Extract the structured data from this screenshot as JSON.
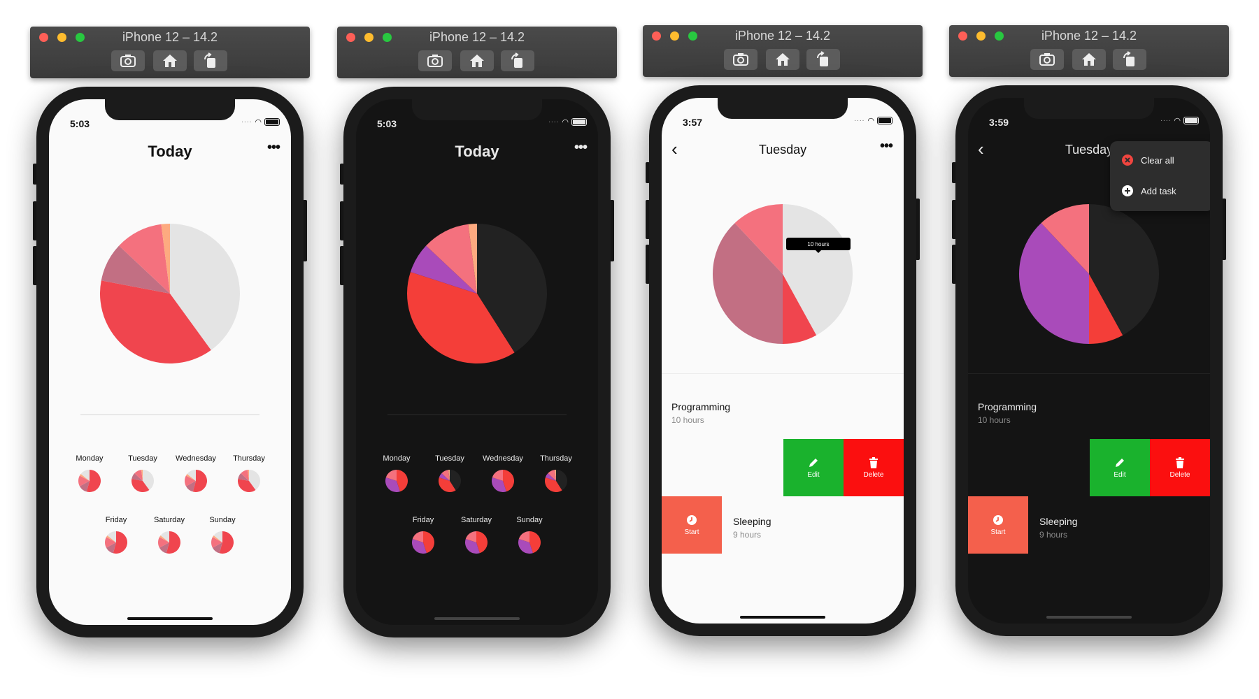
{
  "simulators": [
    {
      "theme": "light",
      "window_title": "iPhone 12 – 14.2",
      "time": "5:03",
      "title": "Today"
    },
    {
      "theme": "dark",
      "window_title": "iPhone 12 – 14.2",
      "time": "5:03",
      "title": "Today"
    },
    {
      "theme": "light",
      "window_title": "iPhone 12 – 14.2",
      "time": "3:57",
      "title": "Tuesday"
    },
    {
      "theme": "dark",
      "window_title": "iPhone 12 – 14.2",
      "time": "3:59",
      "title": "Tuesday"
    }
  ],
  "toolbar_icons": [
    "screenshot-icon",
    "home-icon",
    "rotate-icon"
  ],
  "days": [
    "Monday",
    "Tuesday",
    "Wednesday",
    "Thursday",
    "Friday",
    "Saturday",
    "Sunday"
  ],
  "tasks": [
    {
      "name": "Programming",
      "duration": "10 hours"
    },
    {
      "name": "Sleeping",
      "duration": "9 hours"
    }
  ],
  "actions": {
    "edit": "Edit",
    "delete": "Delete",
    "start": "Start"
  },
  "tooltip": "10 hours",
  "menu": {
    "clear_all": "Clear all",
    "add_task": "Add task"
  },
  "colors": {
    "light_bg": "#fafafa",
    "dark_bg": "#141414",
    "edit": "#1ab22d",
    "delete": "#fb0f0f",
    "start": "#f4604c",
    "pie_grey_light": "#e4e4e4",
    "pie_grey_dark": "#222222",
    "pie_red": "#f43e39",
    "pie_pink": "#f4717e",
    "pie_mauve": "#c26f83",
    "pie_purple": "#a94bba",
    "pie_peach": "#fdaa80"
  },
  "chart_data": [
    {
      "type": "pie",
      "theme": "light",
      "title": "Today",
      "slices": [
        {
          "color": "#e4e4e4",
          "fraction": 0.4
        },
        {
          "color": "#f0454e",
          "fraction": 0.38
        },
        {
          "color": "#c26f83",
          "fraction": 0.09
        },
        {
          "color": "#f4717e",
          "fraction": 0.11
        },
        {
          "color": "#fdaa80",
          "fraction": 0.02
        }
      ]
    },
    {
      "type": "pie",
      "theme": "dark",
      "title": "Today",
      "slices": [
        {
          "color": "#222222",
          "fraction": 0.41
        },
        {
          "color": "#f43e39",
          "fraction": 0.39
        },
        {
          "color": "#a94bba",
          "fraction": 0.07
        },
        {
          "color": "#f4717e",
          "fraction": 0.11
        },
        {
          "color": "#fdaa80",
          "fraction": 0.02
        }
      ]
    },
    {
      "type": "pie",
      "theme": "light",
      "title": "Tuesday",
      "slices": [
        {
          "color": "#e4e4e4",
          "fraction": 0.42
        },
        {
          "color": "#f0454e",
          "fraction": 0.08
        },
        {
          "color": "#c26f83",
          "fraction": 0.38
        },
        {
          "color": "#f4717e",
          "fraction": 0.12
        }
      ]
    },
    {
      "type": "pie",
      "theme": "dark",
      "title": "Tuesday",
      "slices": [
        {
          "color": "#222222",
          "fraction": 0.42
        },
        {
          "color": "#f43e39",
          "fraction": 0.08
        },
        {
          "color": "#a94bba",
          "fraction": 0.38
        },
        {
          "color": "#f4717e",
          "fraction": 0.12
        }
      ]
    }
  ]
}
